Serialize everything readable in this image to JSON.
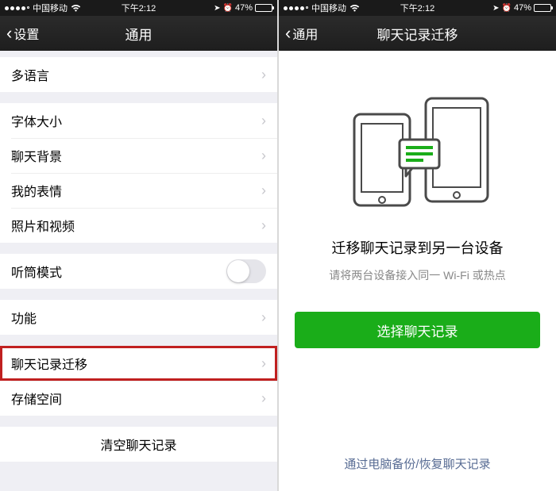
{
  "status_bar": {
    "carrier": "中国移动",
    "time": "下午2:12",
    "battery_pct": "47%"
  },
  "left": {
    "nav": {
      "back": "设置",
      "title": "通用"
    },
    "rows": {
      "multilang": "多语言",
      "fontsize": "字体大小",
      "chat_bg": "聊天背景",
      "stickers": "我的表情",
      "photos_videos": "照片和视频",
      "earpiece_mode": "听筒模式",
      "features": "功能",
      "chat_migrate": "聊天记录迁移",
      "storage": "存储空间",
      "clear_chat": "清空聊天记录"
    }
  },
  "right": {
    "nav": {
      "back": "通用",
      "title": "聊天记录迁移"
    },
    "headline": "迁移聊天记录到另一台设备",
    "subline": "请将两台设备接入同一 Wi-Fi 或热点",
    "primary_button": "选择聊天记录",
    "footer_link": "通过电脑备份/恢复聊天记录"
  }
}
